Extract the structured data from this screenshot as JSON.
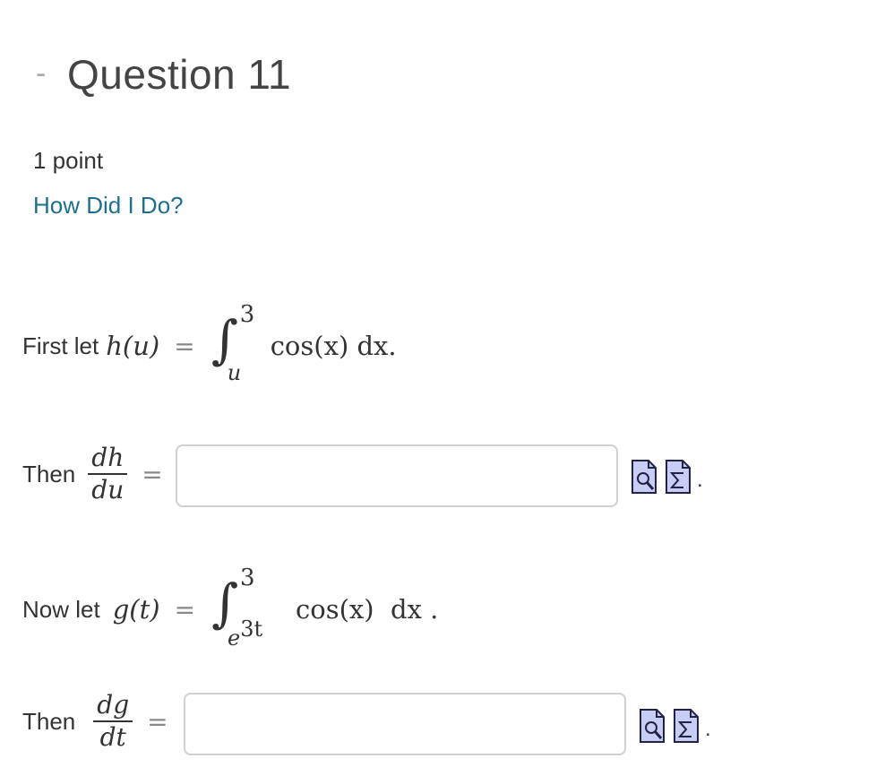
{
  "header": {
    "collapse_symbol": "-",
    "title": "Question 11"
  },
  "meta": {
    "points": "1 point",
    "feedback_link": "How Did I Do?"
  },
  "problem1": {
    "lead": "First let",
    "func": "h(u)",
    "eq": "=",
    "upper_limit": "3",
    "lower_limit": "u",
    "integrand": "cos(x) dx."
  },
  "answer1": {
    "lead": "Then",
    "numerator": "dh",
    "denominator": "du",
    "eq": "=",
    "value": "",
    "placeholder": "",
    "trailing": "."
  },
  "problem2": {
    "lead": "Now let",
    "func": "g(t)",
    "eq": "=",
    "upper_limit": "3",
    "lower_limit_base": "e",
    "lower_limit_exp": "3t",
    "integrand": "cos(x)  dx ."
  },
  "answer2": {
    "lead": "Then",
    "numerator": "dg",
    "denominator": "dt",
    "eq": "=",
    "value": "",
    "placeholder": "",
    "trailing": "."
  },
  "icons": {
    "preview": "preview-icon",
    "equation_editor": "equation-editor-icon",
    "icon_fill": "#c8cdf5",
    "icon_stroke": "#222244"
  },
  "colors": {
    "link": "#1e6f8e",
    "title": "#444444",
    "text": "#333333",
    "input_border": "#d0d0d0"
  }
}
